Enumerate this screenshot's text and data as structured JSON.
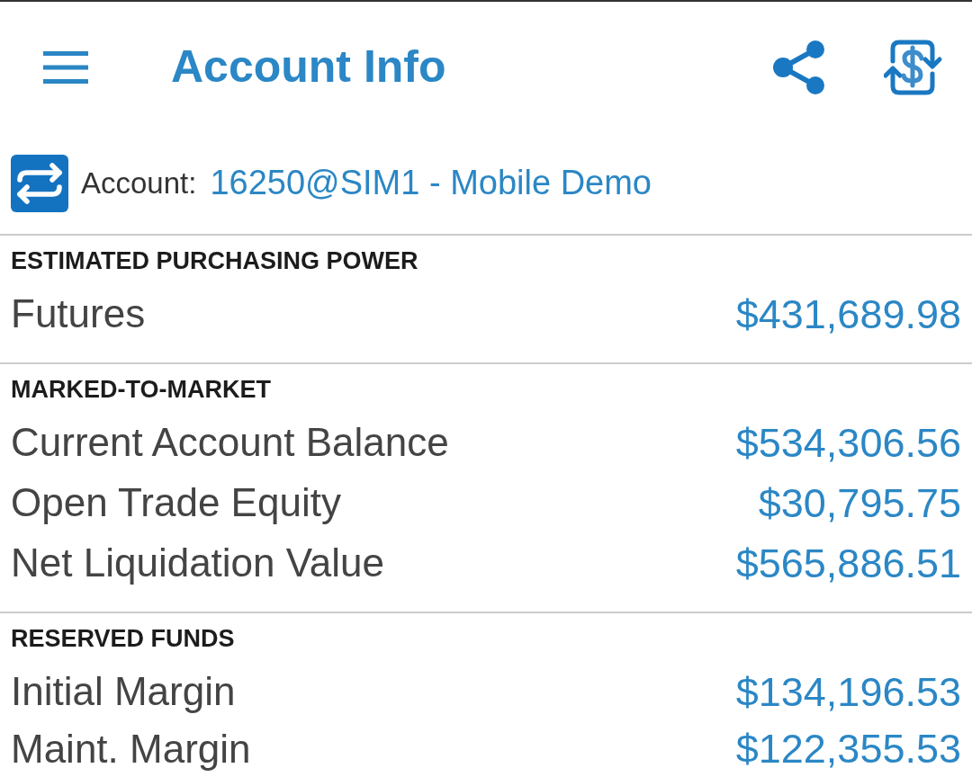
{
  "app_bar": {
    "title": "Account Info"
  },
  "account": {
    "label": "Account:",
    "value": "16250@SIM1 - Mobile Demo"
  },
  "sections": [
    {
      "heading": "ESTIMATED PURCHASING POWER",
      "rows": [
        {
          "label": "Futures",
          "value": "$431,689.98"
        }
      ]
    },
    {
      "heading": "MARKED-TO-MARKET",
      "rows": [
        {
          "label": "Current Account Balance",
          "value": "$534,306.56"
        },
        {
          "label": "Open Trade Equity",
          "value": "$30,795.75"
        },
        {
          "label": "Net Liquidation Value",
          "value": "$565,886.51"
        }
      ]
    },
    {
      "heading": "RESERVED FUNDS",
      "rows": [
        {
          "label": "Initial Margin",
          "value": "$134,196.53"
        },
        {
          "label": "Maint. Margin",
          "value": "$122,355.53"
        }
      ]
    }
  ]
}
